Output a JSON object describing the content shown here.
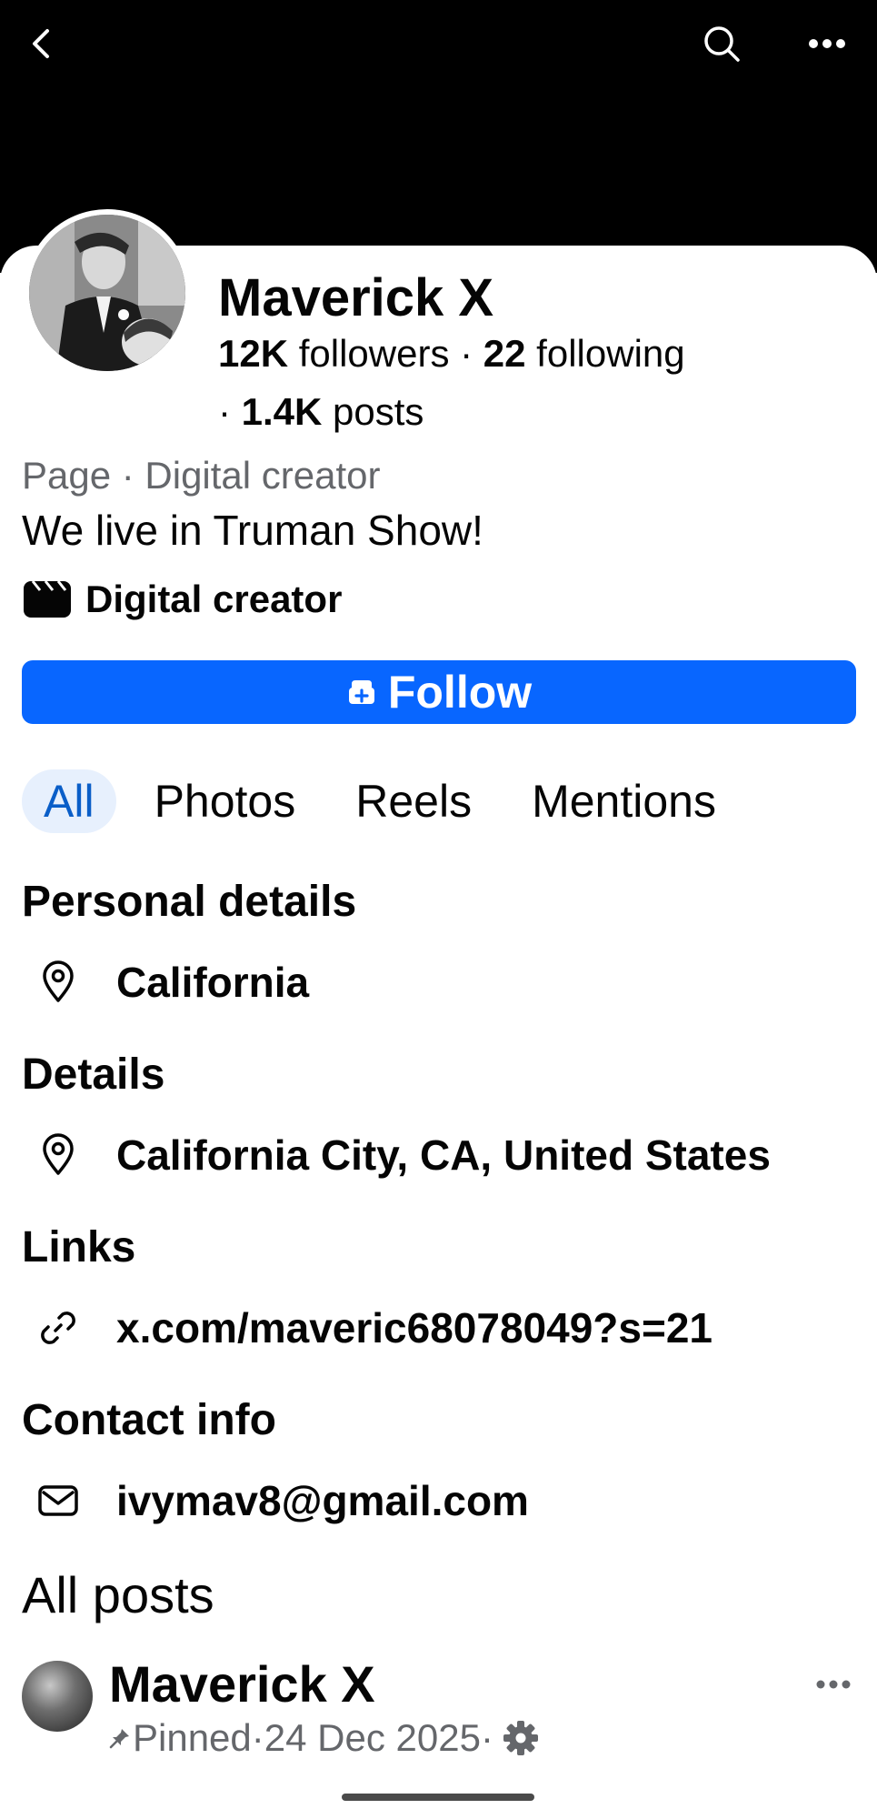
{
  "header": {
    "back_icon": "chevron-left-icon",
    "search_icon": "search-icon",
    "more_icon": "more-horizontal-icon"
  },
  "profile": {
    "name": "Maverick X",
    "followers_count": "12K",
    "followers_label": " followers",
    "following_count": "22",
    "following_label": " following",
    "posts_count": "1.4K",
    "posts_label": " posts",
    "sep": " · ",
    "sep_lead": "· ",
    "subtitle": "Page · Digital creator",
    "bio": "We live in Truman Show!",
    "category": "Digital creator",
    "category_icon": "clapperboard-icon"
  },
  "follow_button": {
    "label": "Follow",
    "icon": "follow-page-icon",
    "color": "#0866ff"
  },
  "tabs": [
    {
      "label": "All",
      "active": true
    },
    {
      "label": "Photos",
      "active": false
    },
    {
      "label": "Reels",
      "active": false
    },
    {
      "label": "Mentions",
      "active": false
    }
  ],
  "sections": {
    "personal_details": {
      "title": "Personal details",
      "location": "California"
    },
    "details": {
      "title": "Details",
      "location": "California City, CA, United States"
    },
    "links": {
      "title": "Links",
      "url": "x.com/maveric68078049?s=21"
    },
    "contact": {
      "title": "Contact info",
      "email": "ivymav8@gmail.com"
    }
  },
  "posts": {
    "title": "All posts",
    "first": {
      "author": "Maverick X",
      "pinned": "Pinned",
      "dot": " · ",
      "date": "24 Dec 2025",
      "dot2": " ·",
      "audience_icon": "gear-icon"
    }
  }
}
